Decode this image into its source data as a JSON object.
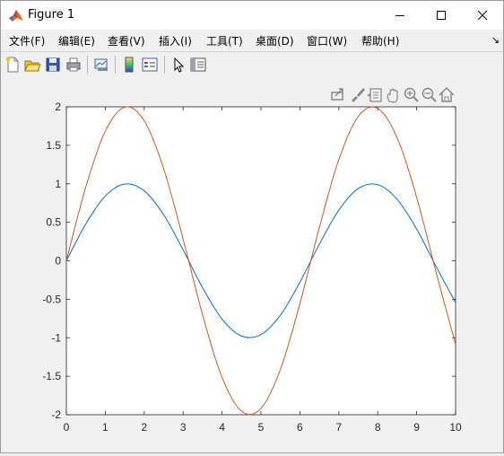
{
  "window": {
    "title": "Figure 1"
  },
  "menu": [
    {
      "label": "文件(F)"
    },
    {
      "label": "编辑(E)"
    },
    {
      "label": "查看(V)"
    },
    {
      "label": "插入(I)"
    },
    {
      "label": "工具(T)"
    },
    {
      "label": "桌面(D)"
    },
    {
      "label": "窗口(W)"
    },
    {
      "label": "帮助(H)"
    }
  ],
  "toolbar": {
    "icons": [
      "new-figure-icon",
      "open-file-icon",
      "save-icon",
      "print-icon",
      "link-plot-icon",
      "insert-colorbar-icon",
      "insert-legend-icon",
      "edit-plot-icon",
      "property-inspector-icon"
    ]
  },
  "axes_toolbar": {
    "icons": [
      "export-icon",
      "brush-icon",
      "data-tip-icon",
      "pan-icon",
      "zoom-in-icon",
      "zoom-out-icon",
      "home-icon"
    ]
  },
  "colors": {
    "series1": "#0072bd",
    "series2": "#d95319",
    "axes_bg": "#ffffff",
    "figure_bg": "#f0f0f0"
  },
  "chart_data": {
    "type": "line",
    "title": "",
    "xlabel": "",
    "ylabel": "",
    "xlim": [
      0,
      10
    ],
    "ylim": [
      -2,
      2
    ],
    "xticks": [
      0,
      1,
      2,
      3,
      4,
      5,
      6,
      7,
      8,
      9,
      10
    ],
    "yticks": [
      2,
      1.5,
      1,
      0.5,
      0,
      -0.5,
      -1,
      -1.5,
      -2
    ],
    "ytick_labels": [
      "2",
      "1.5",
      "1",
      "0.5",
      "0",
      "-0.5",
      "-1",
      "-1.5",
      "-2"
    ],
    "grid": false,
    "series": [
      {
        "x": [
          0,
          0.5,
          1,
          1.5,
          2,
          2.5,
          3,
          3.5,
          4,
          4.5,
          5,
          5.5,
          6,
          6.5,
          7,
          7.5,
          8,
          8.5,
          9,
          9.5,
          10
        ],
        "y": [
          0,
          0.479,
          0.841,
          0.997,
          0.909,
          0.598,
          0.141,
          -0.351,
          -0.757,
          -0.978,
          -0.959,
          -0.706,
          -0.279,
          0.215,
          0.657,
          0.938,
          0.989,
          0.798,
          0.412,
          -0.075,
          -0.544
        ]
      },
      {
        "x": [
          0,
          0.5,
          1,
          1.5,
          2,
          2.5,
          3,
          3.5,
          4,
          4.5,
          5,
          5.5,
          6,
          6.5,
          7,
          7.5,
          8,
          8.5,
          9,
          9.5,
          10
        ],
        "y": [
          0,
          0.959,
          1.683,
          1.995,
          1.819,
          1.197,
          0.282,
          -0.702,
          -1.514,
          -1.955,
          -1.918,
          -1.411,
          -0.559,
          0.43,
          1.314,
          1.876,
          1.979,
          1.596,
          0.824,
          -0.15,
          -1.088
        ]
      }
    ]
  }
}
